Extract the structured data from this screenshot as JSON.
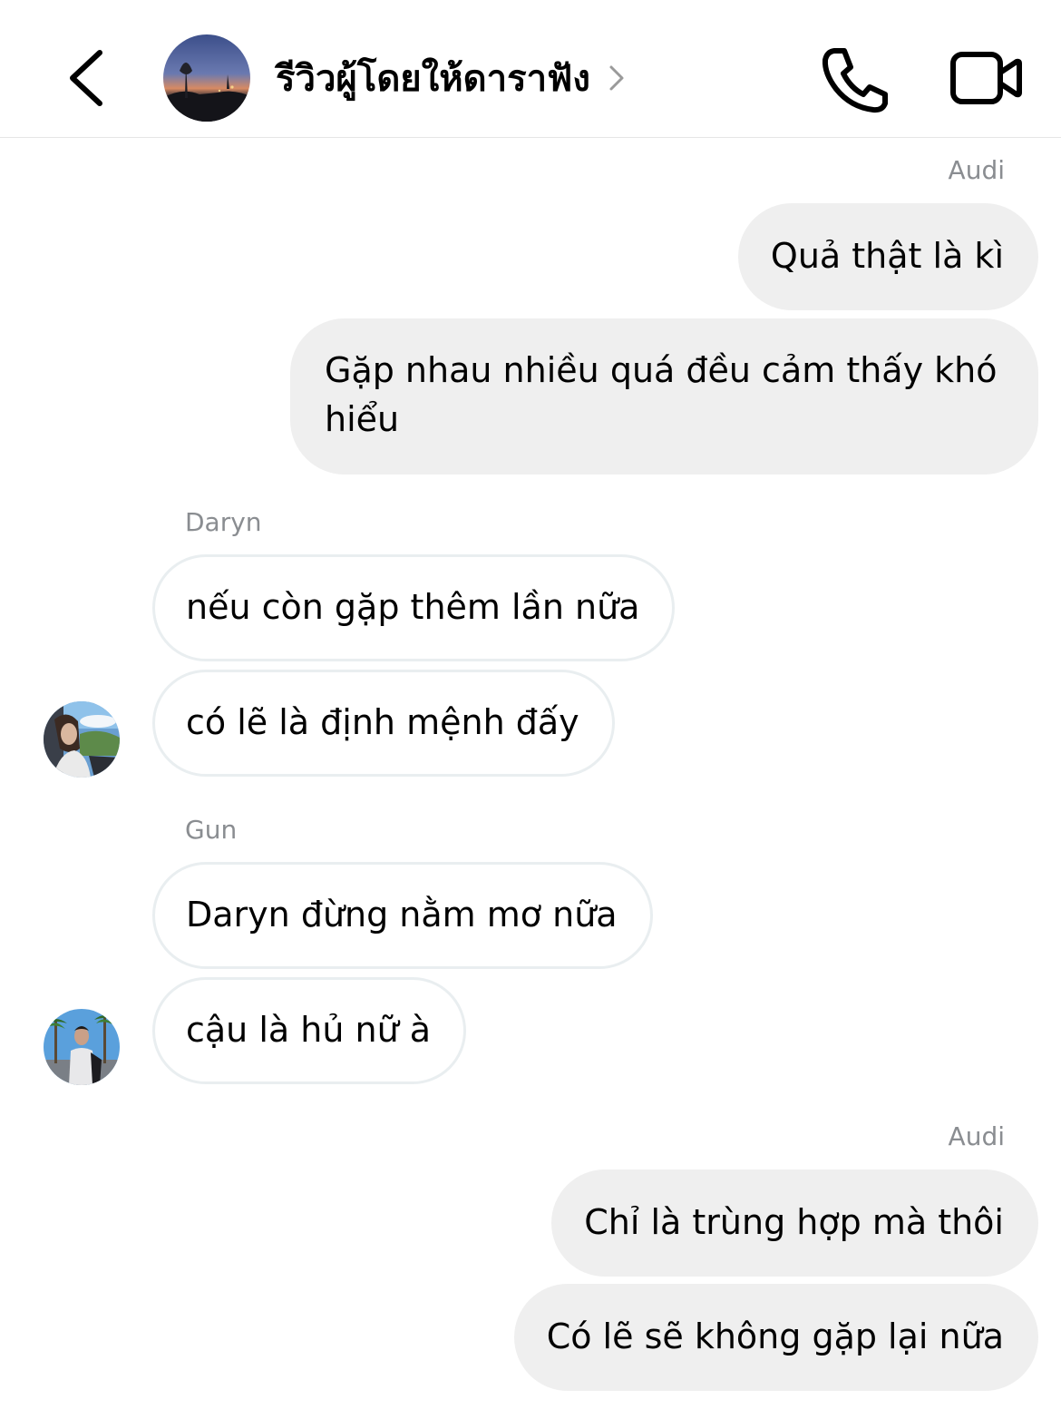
{
  "header": {
    "back_icon": "chevron-left-icon",
    "title": "รีวิวผู้โดยให้ดาราฟัง",
    "title_chevron_icon": "chevron-right-icon",
    "call_icon": "phone-icon",
    "video_icon": "video-camera-icon"
  },
  "messages": [
    {
      "sender": "Audi",
      "text": "Quả thật là kì",
      "direction": "outgoing"
    },
    {
      "sender": "Audi",
      "text": "Gặp nhau nhiều quá đều cảm thấy khó hiểu",
      "direction": "outgoing"
    },
    {
      "sender": "Daryn",
      "text": "nếu còn gặp thêm lần nữa",
      "direction": "incoming"
    },
    {
      "sender": "Daryn",
      "text": "có lẽ là định mệnh đấy",
      "direction": "incoming"
    },
    {
      "sender": "Gun",
      "text": "Daryn đừng nằm mơ nữa",
      "direction": "incoming"
    },
    {
      "sender": "Gun",
      "text": "cậu là hủ nữ à",
      "direction": "incoming"
    },
    {
      "sender": "Audi",
      "text": "Chỉ là trùng hợp mà thôi",
      "direction": "outgoing"
    },
    {
      "sender": "Audi",
      "text": "Có lẽ sẽ không gặp lại nữa",
      "direction": "outgoing"
    }
  ],
  "colors": {
    "outgoing_bubble": "#efefef",
    "incoming_bubble_border": "#e9eef0",
    "sender_label": "#8a8d91",
    "icon": "#000000"
  }
}
